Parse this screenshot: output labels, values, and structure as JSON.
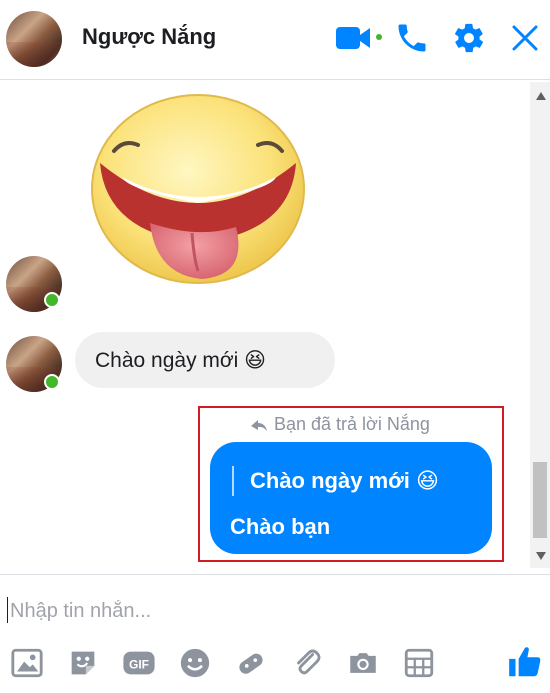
{
  "header": {
    "contact_name": "Ngược Nắng",
    "icons": [
      "video-call-icon",
      "voice-call-icon",
      "settings-icon",
      "close-icon"
    ],
    "online": true
  },
  "conversation": {
    "sticker": "laughing-tongue-out-face-sticker",
    "incoming_message": "Chào ngày mới 😆",
    "reply_note": "Bạn đã trả lời Nắng",
    "outgoing_message": {
      "quoted_text": "Chào ngày mới 😆",
      "text": "Chào bạn"
    }
  },
  "composer": {
    "placeholder": "Nhập tin nhắn...",
    "value": "",
    "tools": [
      "photo-icon",
      "sticker-icon",
      "gif-icon",
      "emoji-icon",
      "game-icon",
      "attachment-icon",
      "camera-icon",
      "calendar-icon"
    ],
    "send_icon": "thumbs-up-icon"
  },
  "colors": {
    "accent": "#0084ff",
    "online": "#42b72a",
    "incoming_bubble": "#f0f0f0",
    "highlight": "#d01c24"
  }
}
